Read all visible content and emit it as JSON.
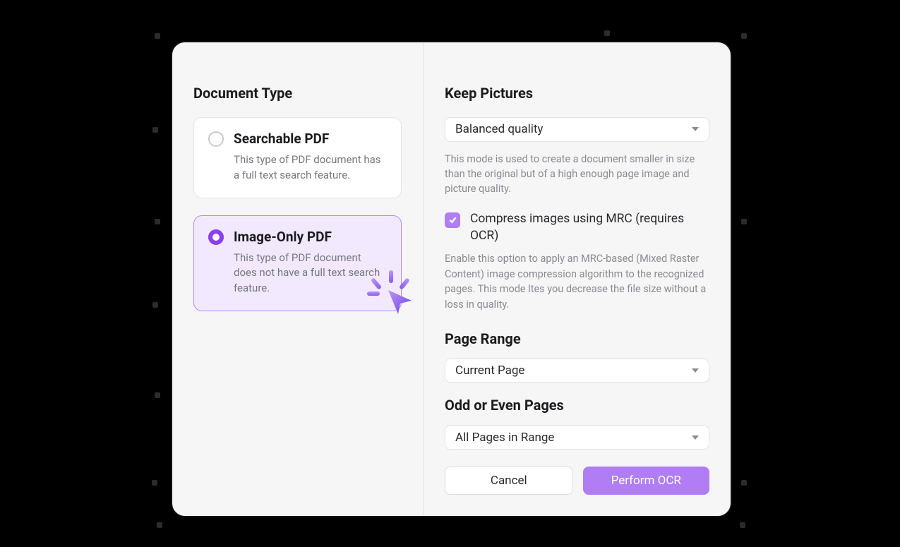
{
  "leftPane": {
    "title": "Document Type",
    "options": [
      {
        "title": "Searchable PDF",
        "desc": "This type of PDF document has a full text search feature."
      },
      {
        "title": "Image-Only PDF",
        "desc": "This type of PDF document does not have a full text search feature."
      }
    ]
  },
  "rightPane": {
    "keepPictures": {
      "title": "Keep Pictures",
      "value": "Balanced quality",
      "help": "This mode is used to create a document smaller in size than the original but of a high enough page image and picture quality."
    },
    "compress": {
      "label": "Compress images using MRC (requires OCR)",
      "help": "Enable this option to apply an MRC-based (Mixed Raster Content) image compression algorithm to the recognized pages. This mode ltes you decrease the file size without a loss in quality."
    },
    "pageRange": {
      "title": "Page Range",
      "value": "Current Page"
    },
    "oddEven": {
      "title": "Odd or Even Pages",
      "value": "All Pages in Range"
    },
    "buttons": {
      "cancel": "Cancel",
      "confirm": "Perform OCR"
    }
  }
}
